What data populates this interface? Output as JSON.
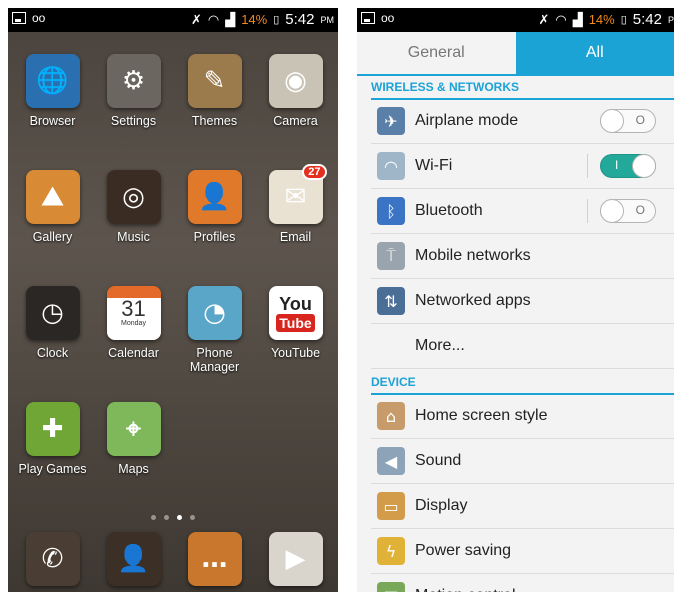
{
  "status_bar": {
    "battery_percent": "14%",
    "time": "5:42",
    "ampm": "PM",
    "ampm_truncated": "P"
  },
  "home": {
    "apps": [
      {
        "label": "Browser",
        "icon": "globe-icon",
        "color": "#2a6fb0"
      },
      {
        "label": "Settings",
        "icon": "gears-icon",
        "color": "#6b6760"
      },
      {
        "label": "Themes",
        "icon": "pencils-icon",
        "color": "#9b7a4c"
      },
      {
        "label": "Camera",
        "icon": "camera-icon",
        "color": "#c9c3b6"
      },
      {
        "label": "Gallery",
        "icon": "landscape-icon",
        "color": "#d88a34"
      },
      {
        "label": "Music",
        "icon": "vinyl-icon",
        "color": "#3a2c22"
      },
      {
        "label": "Profiles",
        "icon": "person-icon",
        "color": "#e07a2a"
      },
      {
        "label": "Email",
        "icon": "envelope-icon",
        "color": "#e9e2d3",
        "badge": "27"
      },
      {
        "label": "Clock",
        "icon": "clock-icon",
        "color": "#2b2724"
      },
      {
        "label": "Calendar",
        "icon": "calendar-icon",
        "color": "#e46a2a",
        "day": "31",
        "weekday": "Monday"
      },
      {
        "label": "Phone\nManager",
        "icon": "gauge-icon",
        "color": "#5aa6c9"
      },
      {
        "label": "YouTube",
        "icon": "youtube-icon",
        "color": "#ffffff",
        "logo_top": "You",
        "logo_bottom": "Tube"
      },
      {
        "label": "Play Games",
        "icon": "gamepad-icon",
        "color": "#6fa636"
      },
      {
        "label": "Maps",
        "icon": "map-icon",
        "color": "#7fb85b"
      }
    ],
    "dock": [
      {
        "icon": "phone-icon",
        "color": "#4a3e34"
      },
      {
        "icon": "contacts-icon",
        "color": "#3b2f26"
      },
      {
        "icon": "messages-icon",
        "color": "#c8772c"
      },
      {
        "icon": "play-store-icon",
        "color": "#d9d4cc"
      }
    ]
  },
  "settings": {
    "tabs": [
      "General",
      "All"
    ],
    "sections": [
      {
        "title": "WIRELESS & NETWORKS",
        "items": [
          {
            "label": "Airplane mode",
            "icon": "airplane-icon",
            "toggle": "off"
          },
          {
            "label": "Wi-Fi",
            "icon": "wifi-icon",
            "toggle": "on"
          },
          {
            "label": "Bluetooth",
            "icon": "bluetooth-icon",
            "toggle": "off"
          },
          {
            "label": "Mobile networks",
            "icon": "antenna-icon"
          },
          {
            "label": "Networked apps",
            "icon": "networked-apps-icon"
          },
          {
            "label": "More..."
          }
        ]
      },
      {
        "title": "DEVICE",
        "items": [
          {
            "label": "Home screen style",
            "icon": "home-icon"
          },
          {
            "label": "Sound",
            "icon": "speaker-icon"
          },
          {
            "label": "Display",
            "icon": "monitor-icon"
          },
          {
            "label": "Power saving",
            "icon": "power-saving-icon"
          },
          {
            "label": "Motion control",
            "icon": "motion-icon"
          }
        ]
      }
    ],
    "toggle_marks": {
      "on": "I",
      "off": "O"
    }
  }
}
